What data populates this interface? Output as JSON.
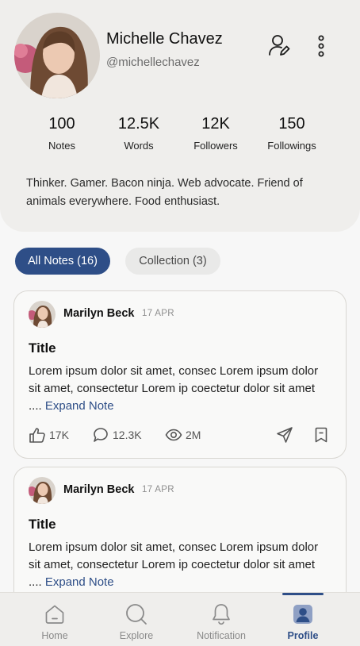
{
  "profile": {
    "name": "Michelle Chavez",
    "handle": "@michellechavez",
    "bio": "Thinker. Gamer. Bacon ninja. Web advocate. Friend of animals everywhere. Food enthusiast.",
    "stats": [
      {
        "value": "100",
        "label": "Notes"
      },
      {
        "value": "12.5K",
        "label": "Words"
      },
      {
        "value": "12K",
        "label": "Followers"
      },
      {
        "value": "150",
        "label": "Followings"
      }
    ],
    "icons": {
      "edit": "user-edit-icon",
      "more": "more-vertical-icon"
    }
  },
  "tabs": [
    {
      "label": "All Notes (16)",
      "active": true
    },
    {
      "label": "Collection (3)",
      "active": false
    }
  ],
  "notes": [
    {
      "author": "Marilyn Beck",
      "date": "17 APR",
      "title": "Title",
      "body": "Lorem ipsum dolor sit amet, consec Lorem ipsum dolor sit amet, consectetur Lorem ip coectetur dolor sit amet .... ",
      "expand": "Expand Note",
      "likes": "17K",
      "comments": "12.3K",
      "views": "2M"
    },
    {
      "author": "Marilyn Beck",
      "date": "17 APR",
      "title": "Title",
      "body": "Lorem ipsum dolor sit amet, consec Lorem ipsum dolor sit amet, consectetur Lorem ip coectetur dolor sit amet .... ",
      "expand": "Expand Note"
    }
  ],
  "bottom_nav": [
    {
      "label": "Home",
      "icon": "home-icon"
    },
    {
      "label": "Explore",
      "icon": "search-icon"
    },
    {
      "label": "Notification",
      "icon": "bell-icon"
    },
    {
      "label": "Profile",
      "icon": "profile-icon",
      "active": true
    }
  ],
  "colors": {
    "accent": "#2e4e87",
    "header_bg": "#efeeec",
    "page_bg": "#f7f7f7"
  }
}
